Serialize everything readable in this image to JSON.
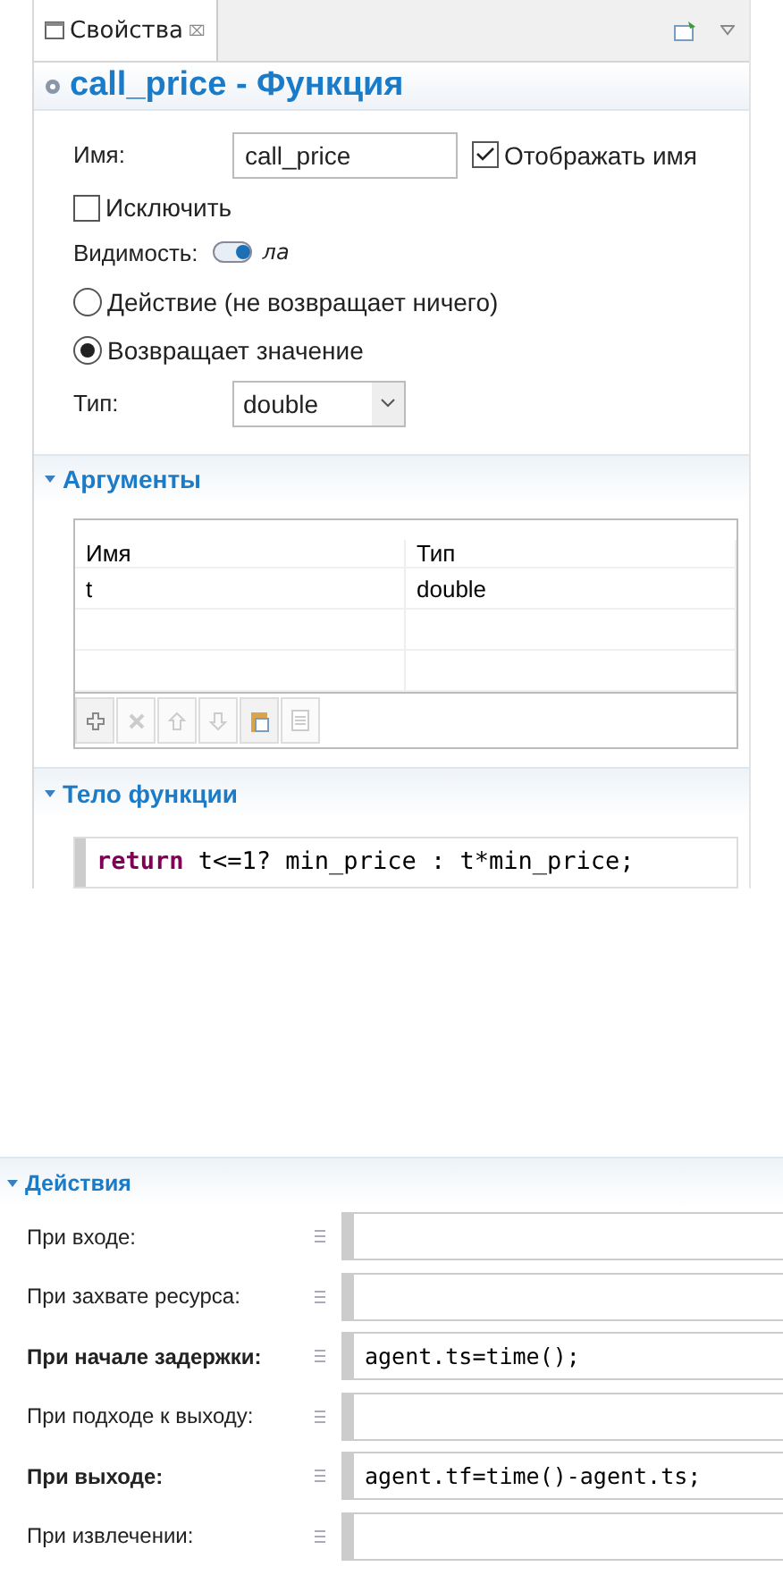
{
  "tab": {
    "label": "Свойства",
    "close": "⌧"
  },
  "title": "call_price - Функция",
  "name_field": {
    "label": "Имя:",
    "value": "call_price"
  },
  "show_name": {
    "label": "Отображать имя",
    "checked": true
  },
  "exclude": {
    "label": "Исключить",
    "checked": false
  },
  "visibility": {
    "label": "Видимость:",
    "on": true,
    "value": "ла"
  },
  "return_options": [
    {
      "label": "Действие (не возвращает ничего)",
      "selected": false
    },
    {
      "label": "Возвращает значение",
      "selected": true
    }
  ],
  "type_field": {
    "label": "Тип:",
    "value": "double"
  },
  "arguments": {
    "title": "Аргументы",
    "expanded": true,
    "columns": [
      "Имя",
      "Тип"
    ],
    "rows": [
      [
        "t",
        "double"
      ],
      [
        "",
        ""
      ],
      [
        "",
        ""
      ]
    ],
    "tools": [
      {
        "kind": "add",
        "disabled": false
      },
      {
        "kind": "delete",
        "disabled": true
      },
      {
        "kind": "up",
        "disabled": true
      },
      {
        "kind": "down",
        "disabled": true
      },
      {
        "kind": "paste",
        "disabled": false
      },
      {
        "kind": "copy",
        "disabled": true
      }
    ]
  },
  "body": {
    "title": "Тело функции",
    "expanded": true,
    "keyword": "return",
    "code": " t<=1? min_price : t*min_price;"
  },
  "actions": {
    "title": "Действия",
    "expanded": true,
    "rows": [
      {
        "label": "При входе:",
        "bold": false,
        "code": ""
      },
      {
        "label": "При захвате ресурса:",
        "bold": false,
        "code": ""
      },
      {
        "label": "При начале задержки:",
        "bold": true,
        "code": "agent.ts=time();"
      },
      {
        "label": "При подходе к выходу:",
        "bold": false,
        "code": ""
      },
      {
        "label": "При выходе:",
        "bold": true,
        "code": "agent.tf=time()-agent.ts;"
      },
      {
        "label": "При извлечении:",
        "bold": false,
        "code": ""
      }
    ]
  }
}
